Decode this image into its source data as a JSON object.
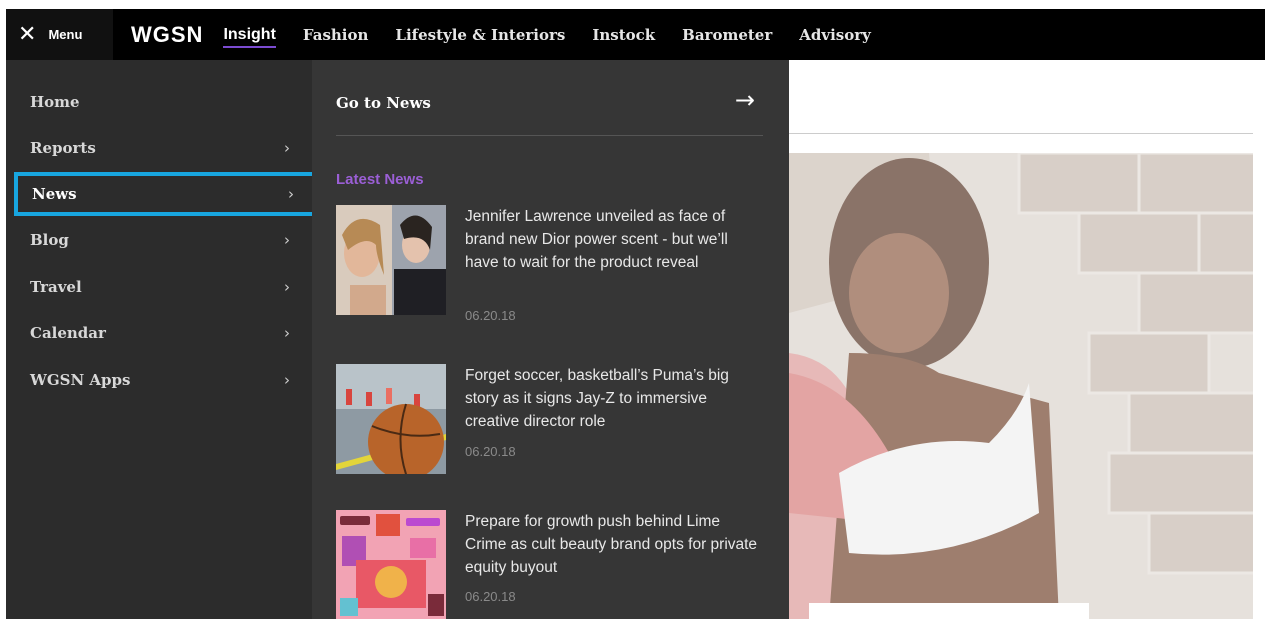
{
  "topbar": {
    "menu_label": "Menu",
    "close_glyph": "✕",
    "logo": "WGSN",
    "nav": [
      "Insight",
      "Fashion",
      "Lifestyle & Interiors",
      "Instock",
      "Barometer",
      "Advisory"
    ]
  },
  "sidebar": {
    "items": [
      {
        "label": "Home"
      },
      {
        "label": "Reports"
      },
      {
        "label": "News"
      },
      {
        "label": "Blog"
      },
      {
        "label": "Travel"
      },
      {
        "label": "Calendar"
      },
      {
        "label": "WGSN Apps"
      }
    ],
    "chevron": "›"
  },
  "submenu": {
    "goto_label": "Go to News",
    "arrow": "→",
    "section_label": "Latest News",
    "news": [
      {
        "title": "Jennifer Lawrence unveiled as face of brand new Dior power scent - but we’ll have to wait for the product reveal",
        "date": "06.20.18",
        "thumb_icon": "portrait-photo-icon"
      },
      {
        "title": "Forget soccer, basketball’s Puma’s big story as it signs Jay-Z to immersive creative director role",
        "date": "06.20.18",
        "thumb_icon": "basketball-photo-icon"
      },
      {
        "title": "Prepare for growth push behind Lime Crime as cult beauty brand opts for private equity buyout",
        "date": "06.20.18",
        "thumb_icon": "cosmetics-photo-icon"
      }
    ]
  },
  "colors": {
    "accent_purple": "#9b5fd6",
    "selection_blue": "#18a6e0",
    "topbar_bg": "#000000",
    "sidebar_bg": "#2c2c2c",
    "submenu_bg": "#363636"
  }
}
